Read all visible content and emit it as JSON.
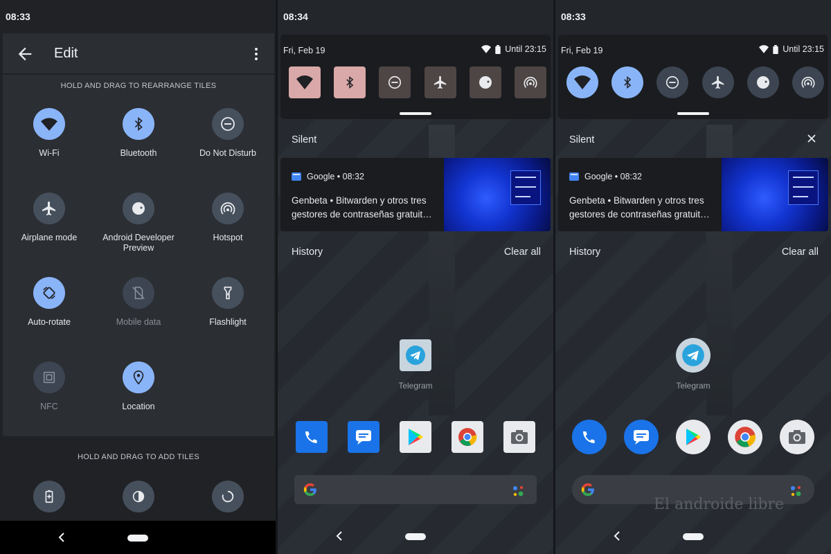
{
  "panel_edit": {
    "time": "08:33",
    "title": "Edit",
    "rearrange_header": "HOLD AND DRAG TO REARRANGE TILES",
    "add_header": "HOLD AND DRAG TO ADD TILES",
    "tiles": [
      {
        "label": "Wi-Fi",
        "icon": "wifi-icon",
        "state": "on"
      },
      {
        "label": "Bluetooth",
        "icon": "bluetooth-icon",
        "state": "on"
      },
      {
        "label": "Do Not Disturb",
        "icon": "do-not-disturb-icon",
        "state": "off"
      },
      {
        "label": "Airplane mode",
        "icon": "airplane-icon",
        "state": "off"
      },
      {
        "label": "Android Developer Preview",
        "icon": "developer-preview-icon",
        "state": "off"
      },
      {
        "label": "Hotspot",
        "icon": "hotspot-icon",
        "state": "off"
      },
      {
        "label": "Auto-rotate",
        "icon": "auto-rotate-icon",
        "state": "on"
      },
      {
        "label": "Mobile data",
        "icon": "mobile-data-icon",
        "state": "unavailable"
      },
      {
        "label": "Flashlight",
        "icon": "flashlight-icon",
        "state": "off"
      },
      {
        "label": "NFC",
        "icon": "nfc-icon",
        "state": "unavailable"
      },
      {
        "label": "Location",
        "icon": "location-icon",
        "state": "on"
      }
    ],
    "add_tiles": [
      {
        "icon": "battery-saver-icon"
      },
      {
        "icon": "invert-colors-icon"
      },
      {
        "icon": "data-saver-icon"
      }
    ]
  },
  "panel_shade_1": {
    "time": "08:34",
    "date": "Fri, Feb 19",
    "battery_text": "Until 23:15",
    "silent_label": "Silent",
    "notification": {
      "app": "Google • 08:32",
      "line1": "Genbeta • Bitwarden y otros tres",
      "line2": "gestores de contraseñas gratuit…"
    },
    "history_label": "History",
    "clear_all_label": "Clear all",
    "app_label": "Telegram"
  },
  "panel_shade_2": {
    "time": "08:33",
    "date": "Fri, Feb 19",
    "battery_text": "Until 23:15",
    "silent_label": "Silent",
    "notification": {
      "app": "Google • 08:32",
      "line1": "Genbeta • Bitwarden y otros tres",
      "line2": "gestores de contraseñas gratuit…"
    },
    "history_label": "History",
    "clear_all_label": "Clear all",
    "app_label": "Telegram"
  },
  "watermark": "El androide libre",
  "colors": {
    "accent_on": "#8ab4f8",
    "tile_off": "#46505c",
    "qs_pink": "#d9a8a8",
    "qs_brown": "#4e4545"
  }
}
